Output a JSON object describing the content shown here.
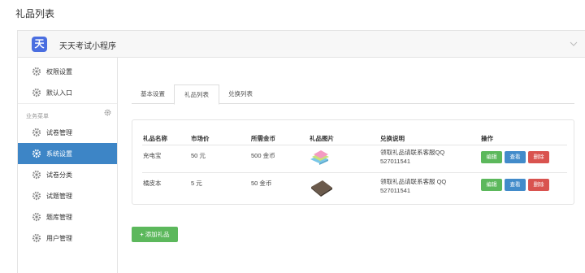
{
  "page": {
    "title": "礼品列表"
  },
  "app": {
    "logo_text": "天",
    "name": "天天考试小程序",
    "accent": "#3d85c6"
  },
  "sidebar": {
    "top_items": [
      {
        "label": "权限设置",
        "icon": "gear-icon"
      },
      {
        "label": "默认入口",
        "icon": "gear-icon"
      }
    ],
    "section_label": "业务菜单",
    "items": [
      {
        "label": "试卷管理",
        "icon": "gear-icon",
        "active": false
      },
      {
        "label": "系统设置",
        "icon": "gear-icon",
        "active": true
      },
      {
        "label": "试卷分类",
        "icon": "gear-icon",
        "active": false
      },
      {
        "label": "试题管理",
        "icon": "gear-icon",
        "active": false
      },
      {
        "label": "题库管理",
        "icon": "gear-icon",
        "active": false
      },
      {
        "label": "用户管理",
        "icon": "gear-icon",
        "active": false
      }
    ]
  },
  "tabs": [
    {
      "label": "基本设置",
      "active": false
    },
    {
      "label": "礼品列表",
      "active": true
    },
    {
      "label": "兑换列表",
      "active": false
    }
  ],
  "table": {
    "headers": [
      "礼品名称",
      "市场价",
      "所需金币",
      "礼品图片",
      "兑换说明",
      "操作"
    ],
    "rows": [
      {
        "name": "充电宝",
        "price": "50 元",
        "coins": "500 金币",
        "image": "power-bank-image",
        "desc_line1": "领取礼品请联系客服QQ",
        "desc_line2": "527011541",
        "actions": [
          "编辑",
          "查看",
          "删除"
        ]
      },
      {
        "name": "橘皮本",
        "price": "5 元",
        "coins": "50 金币",
        "image": "notebook-image",
        "desc_line1": "领取礼品请联系客服 QQ",
        "desc_line2": "527011541",
        "actions": [
          "编辑",
          "查看",
          "删除"
        ]
      }
    ]
  },
  "add_button": {
    "icon": "plus-icon",
    "label": "添加礼品"
  }
}
